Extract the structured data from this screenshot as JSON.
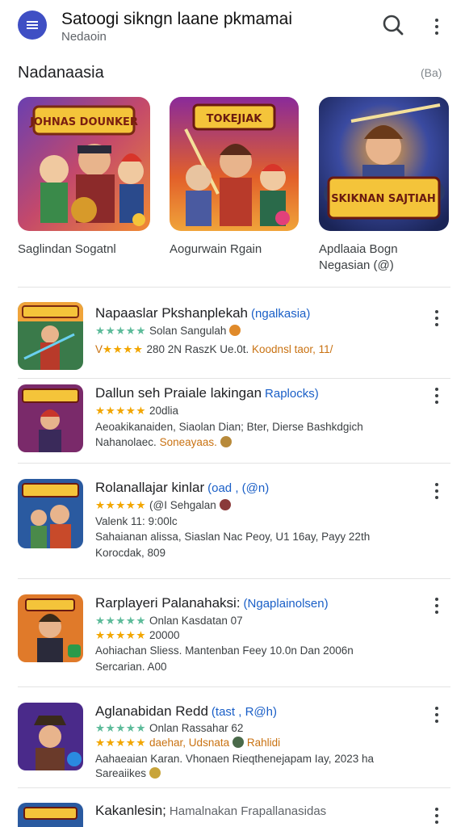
{
  "header": {
    "title": "Satoogi sikngn laane pkmamai",
    "subtitle": "Nedaoin",
    "menu_icon": "menu-icon",
    "search_icon": "search-icon",
    "more_icon": "more-vert-icon"
  },
  "section": {
    "title": "Nadanaasia",
    "more_label": "(Ba)"
  },
  "featured": [
    {
      "banner": "JOHNAS DOUNKER",
      "label": "Saglindan Sogatnl"
    },
    {
      "banner": "TOKEJIAK",
      "label": "Aogurwain Rgain"
    },
    {
      "banner": "SKIKNAN SAJTIAH",
      "label": "Apdlaaia Bogn Negasian (@)"
    }
  ],
  "list": [
    {
      "title": "Napaaslar Pkshanplekah",
      "tag": "(ngalkasia)",
      "line1_stars": "★★★★★",
      "line1": "Solan Sangulah",
      "line2_stars": "★★★★",
      "line2_prefix": "V",
      "line2": "280 2N RaszK Ue.0t.",
      "line2_orange": "Koodnsl taor, 11/"
    },
    {
      "title": "Dallun seh Praiale lakingan",
      "tag": "Raplocks)",
      "line1_stars": "★★★★★",
      "line1": "20dlia",
      "line2": "Aeoakikanaiden, Siaolan Dian; Bter, Dierse Bashkdgich",
      "line3": "Nahanolaec.",
      "line3_orange": "Soneayaas."
    },
    {
      "title": "Rolanallajar kinlar",
      "tag": "(oad , (@n)",
      "line1_stars": "★★★★★",
      "line1": "(@I Sehgalan",
      "line2": "Valenk 11: 9:00lc",
      "line3": "Sahaianan alissa, Siaslan Nac Peoy, U1 16ay, Payy 22th",
      "line4": "Korocdak, 809"
    },
    {
      "title": "Rarplayeri Palanahaksi:",
      "tag": "(Ngaplainolsen)",
      "line1_stars": "★★★★★",
      "line1": "Onlan Kasdatan 07",
      "line2_stars": "★★★★★",
      "line2": "20000",
      "line3": "Aohiachan Sliess. Mantenban Feey 10.0n Dan 2006n",
      "line4": "Sercarian. A00"
    },
    {
      "title": "Aglanabidan Redd",
      "tag": "(tast , R@h)",
      "line1_stars": "★★★★★",
      "line1": "Onlan Rassahar 62",
      "line2_stars": "★★★★★",
      "line2_orange": "daehar, Udsnata",
      "line2": "Rahlidi",
      "line3": "Aahaeaian Karan. Vhonaen Rieqthenejapam Iay, 2023 ha",
      "line4": "Sareaiikes"
    },
    {
      "title": "Kakanlesin;",
      "tag": "",
      "line1": "Hamalnakan Frapallanasidas"
    }
  ],
  "colors": {
    "accent": "#3f4fc4",
    "link": "#1a5fc7",
    "star": "#f2a600",
    "teal_star": "#5dbb9a",
    "orange_text": "#c97212"
  }
}
